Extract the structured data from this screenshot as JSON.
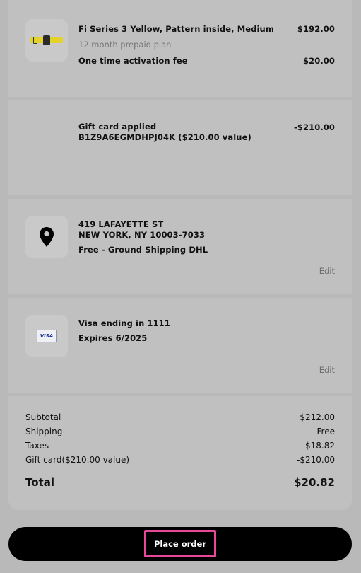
{
  "order_item": {
    "name": "Fi Series 3 Yellow, Pattern inside, Medium",
    "price": "$192.00",
    "plan": "12 month prepaid plan",
    "activation_label": "One time activation fee",
    "activation_price": "$20.00"
  },
  "gift_card": {
    "label": "Gift card applied",
    "code": "B1Z9A6EGMDHPJ04K ($210.00 value)",
    "amount": "-$210.00"
  },
  "shipping": {
    "address_line1": "419 LAFAYETTE ST",
    "address_line2": "NEW YORK, NY 10003-7033",
    "method": "Free - Ground Shipping DHL",
    "edit_label": "Edit"
  },
  "payment": {
    "card": "Visa ending in 1111",
    "expires": "Expires 6/2025",
    "edit_label": "Edit",
    "icon_text": "VISA"
  },
  "summary": {
    "rows": [
      {
        "label": "Subtotal",
        "value": "$212.00"
      },
      {
        "label": "Shipping",
        "value": "Free"
      },
      {
        "label": "Taxes",
        "value": "$18.82"
      },
      {
        "label": "Gift card($210.00 value)",
        "value": "-$210.00"
      }
    ],
    "total_label": "Total",
    "total_value": "$20.82"
  },
  "actions": {
    "place_order": "Place order"
  },
  "colors": {
    "highlight": "#e8479a",
    "button_bg": "#000000"
  }
}
